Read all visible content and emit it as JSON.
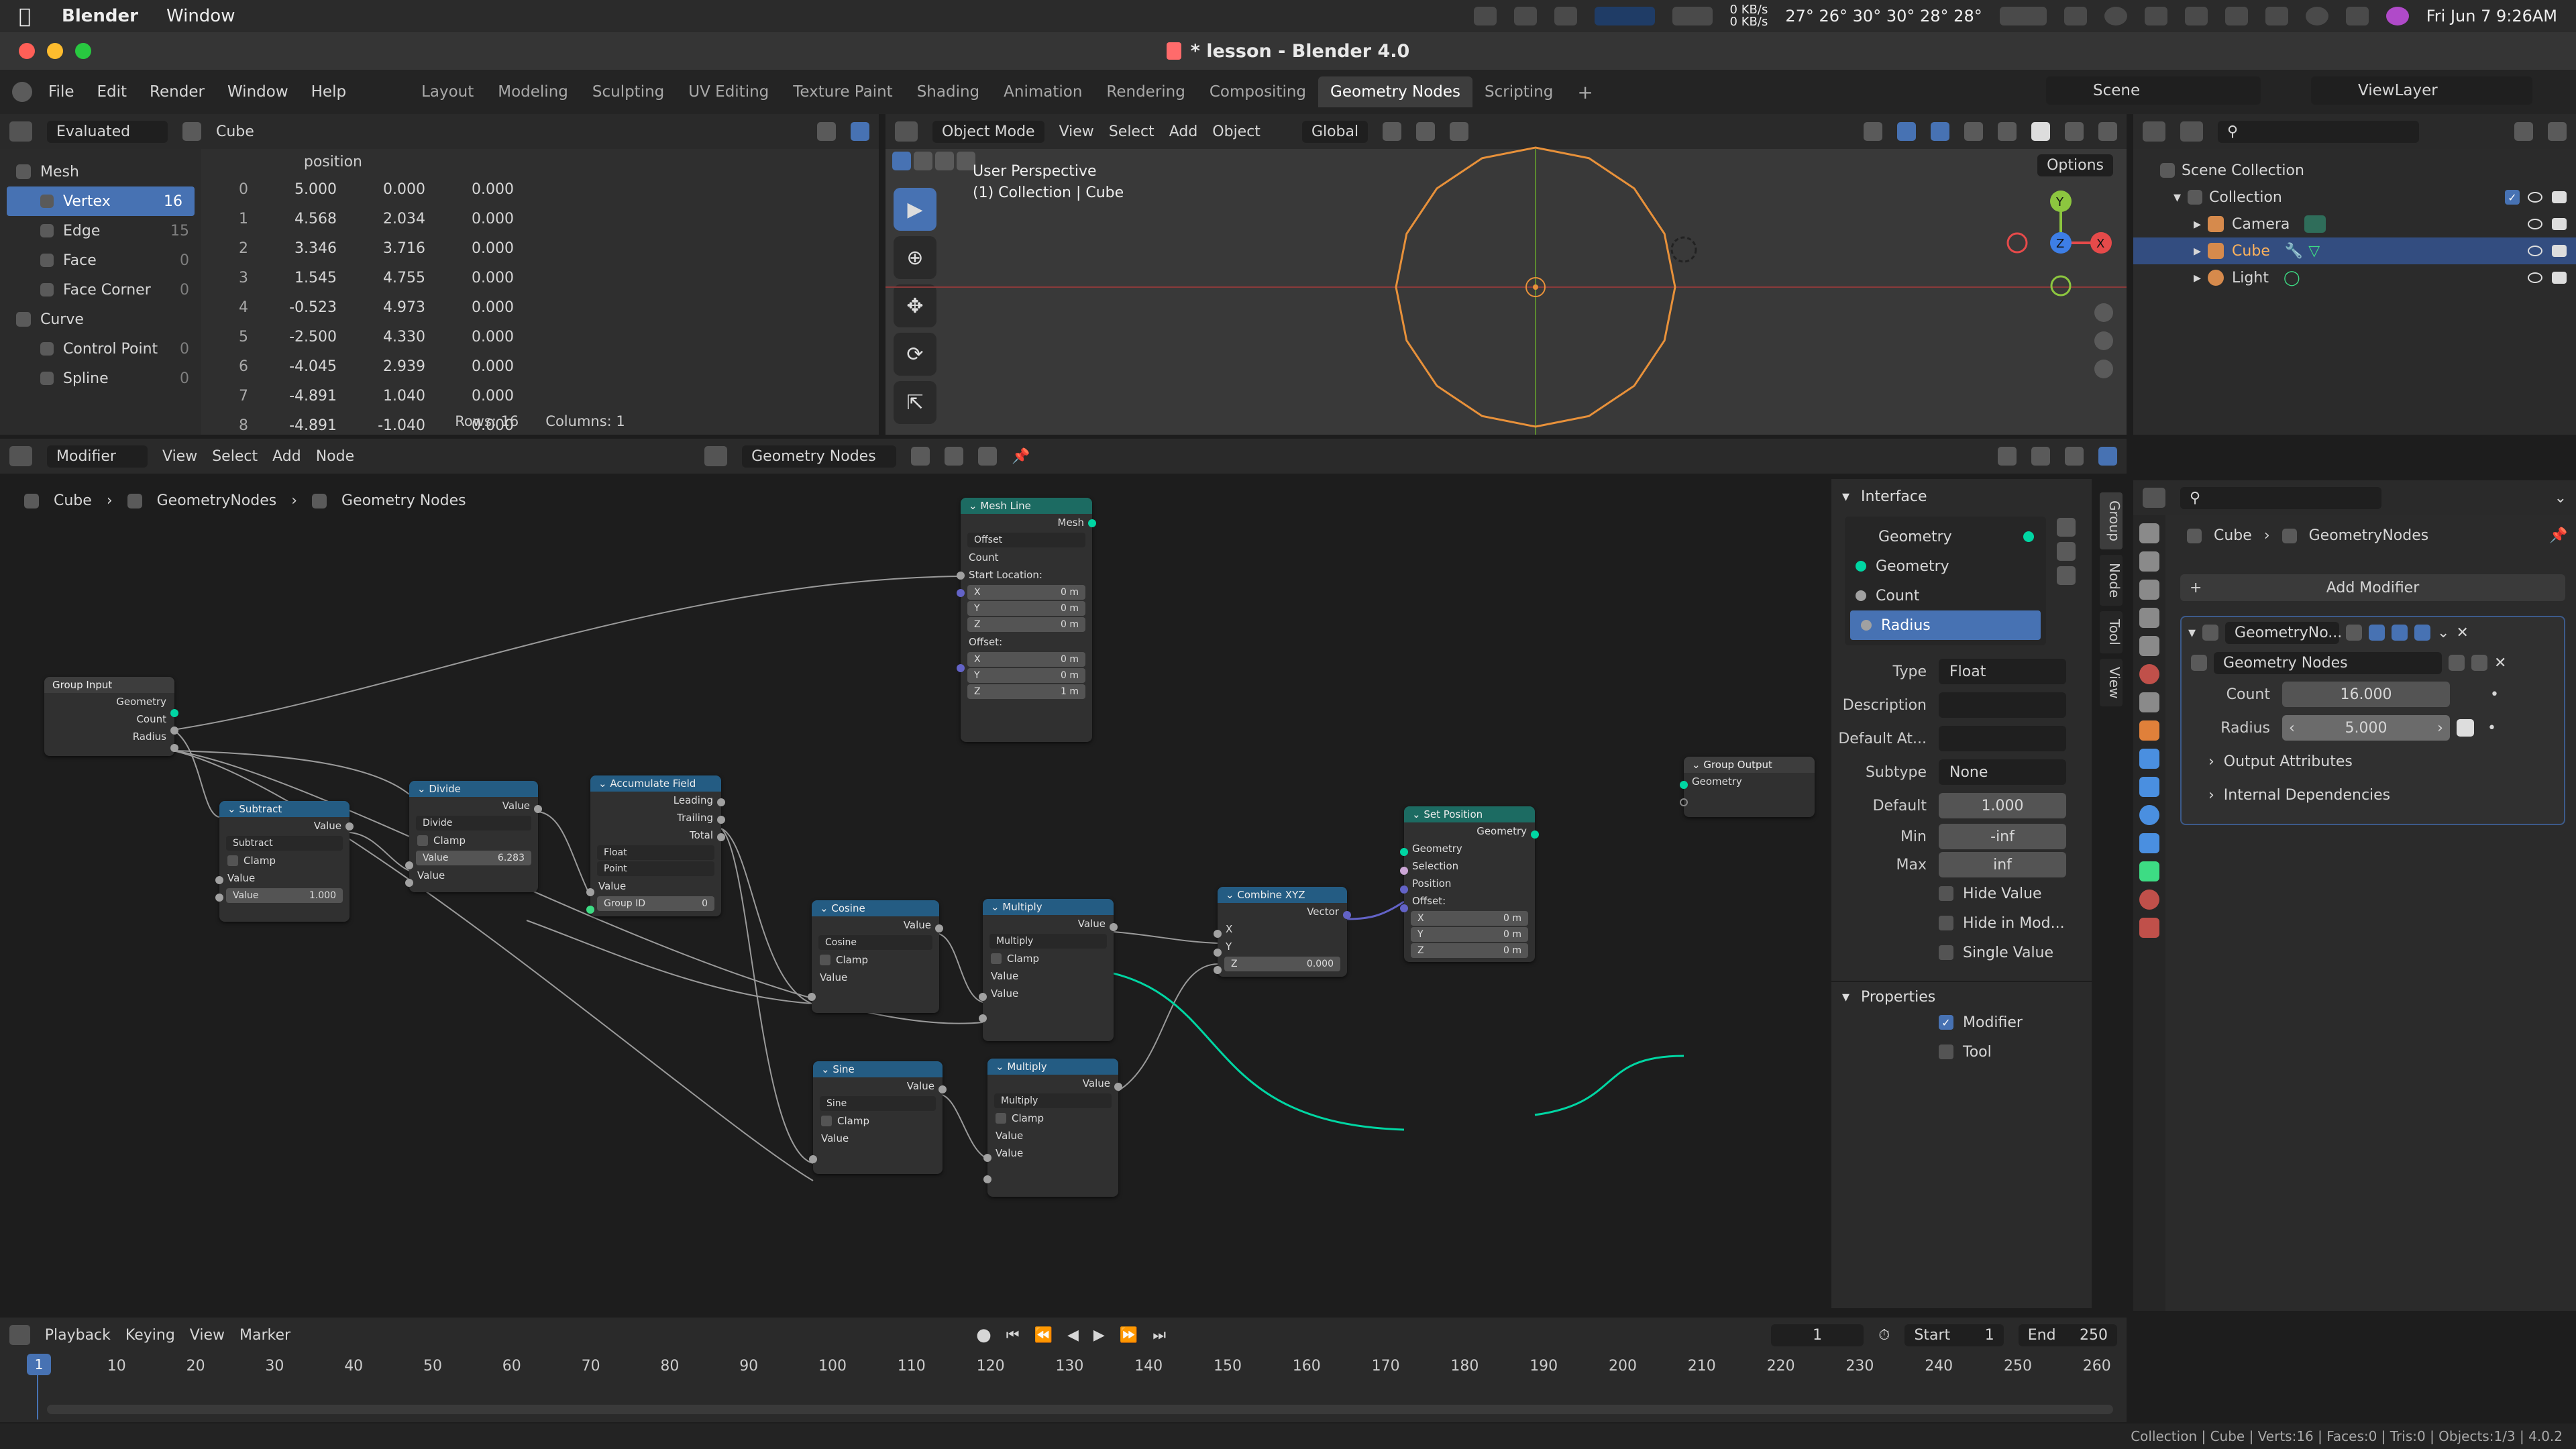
{
  "menubar": {
    "app": "Blender",
    "menu": "Window",
    "net_up": "0 KB/s",
    "net_down": "0 KB/s",
    "temps": "27° 26° 30° 30° 28° 28°",
    "datetime": "Fri Jun 7  9:26AM"
  },
  "window": {
    "title": "* lesson - Blender 4.0"
  },
  "topbar": {
    "menus": [
      "File",
      "Edit",
      "Render",
      "Window",
      "Help"
    ],
    "workspaces": [
      "Layout",
      "Modeling",
      "Sculpting",
      "UV Editing",
      "Texture Paint",
      "Shading",
      "Animation",
      "Rendering",
      "Compositing",
      "Geometry Nodes",
      "Scripting"
    ],
    "active_workspace": "Geometry Nodes",
    "scene": "Scene",
    "view_layer": "ViewLayer"
  },
  "spreadsheet": {
    "mode": "Evaluated",
    "object": "Cube",
    "column_header": "position",
    "domains": [
      {
        "group": "Mesh"
      },
      {
        "label": "Vertex",
        "count": "16",
        "selected": true
      },
      {
        "label": "Edge",
        "count": "15"
      },
      {
        "label": "Face",
        "count": "0"
      },
      {
        "label": "Face Corner",
        "count": "0"
      },
      {
        "group": "Curve"
      },
      {
        "label": "Control Point",
        "count": "0"
      },
      {
        "label": "Spline",
        "count": "0"
      }
    ],
    "rows": [
      [
        "0",
        "5.000",
        "0.000",
        "0.000"
      ],
      [
        "1",
        "4.568",
        "2.034",
        "0.000"
      ],
      [
        "2",
        "3.346",
        "3.716",
        "0.000"
      ],
      [
        "3",
        "1.545",
        "4.755",
        "0.000"
      ],
      [
        "4",
        "-0.523",
        "4.973",
        "0.000"
      ],
      [
        "5",
        "-2.500",
        "4.330",
        "0.000"
      ],
      [
        "6",
        "-4.045",
        "2.939",
        "0.000"
      ],
      [
        "7",
        "-4.891",
        "1.040",
        "0.000"
      ],
      [
        "8",
        "-4.891",
        "-1.040",
        "0.000"
      ]
    ],
    "rows_label": "Rows: 16",
    "cols_label": "Columns: 1"
  },
  "viewport": {
    "mode": "Object Mode",
    "menus": [
      "View",
      "Select",
      "Add",
      "Object"
    ],
    "orientation": "Global",
    "options": "Options",
    "info_line1": "User Perspective",
    "info_line2": "(1) Collection | Cube"
  },
  "node_editor": {
    "header_mode": "Modifier",
    "menus": [
      "View",
      "Select",
      "Add",
      "Node"
    ],
    "tree_name": "Geometry Nodes",
    "breadcrumb": [
      "Cube",
      "GeometryNodes",
      "Geometry Nodes"
    ],
    "nodes": {
      "group_input": {
        "title": "Group Input",
        "out": [
          "Geometry",
          "Count",
          "Radius"
        ]
      },
      "subtract": {
        "title": "Subtract",
        "out": "Value",
        "op": "Subtract",
        "clamp": "Clamp",
        "in": "Value",
        "val_label": "Value",
        "val": "1.000"
      },
      "divide": {
        "title": "Divide",
        "out": "Value",
        "op": "Divide",
        "clamp": "Clamp",
        "val_label": "Value",
        "val": "6.283",
        "in": "Value"
      },
      "accumulate": {
        "title": "Accumulate Field",
        "outs": [
          "Leading",
          "Trailing",
          "Total"
        ],
        "type": "Float",
        "domain": "Point",
        "in": "Value",
        "gid": "Group ID",
        "gid_val": "0"
      },
      "mesh_line": {
        "title": "Mesh Line",
        "out": "Mesh",
        "mode": "Offset",
        "count": "Count",
        "start": "Start Location:",
        "sx": "0 m",
        "sy": "0 m",
        "sz": "0 m",
        "offset": "Offset:",
        "ox": "0 m",
        "oy": "0 m",
        "oz": "1 m"
      },
      "cosine": {
        "title": "Cosine",
        "out": "Value",
        "op": "Cosine",
        "clamp": "Clamp",
        "in": "Value"
      },
      "sine": {
        "title": "Sine",
        "out": "Value",
        "op": "Sine",
        "clamp": "Clamp",
        "in": "Value"
      },
      "multiply1": {
        "title": "Multiply",
        "out": "Value",
        "op": "Multiply",
        "clamp": "Clamp",
        "in1": "Value",
        "in2": "Value"
      },
      "multiply2": {
        "title": "Multiply",
        "out": "Value",
        "op": "Multiply",
        "clamp": "Clamp",
        "in1": "Value",
        "in2": "Value"
      },
      "combine": {
        "title": "Combine XYZ",
        "out": "Vector",
        "x": "X",
        "y": "Y",
        "z": "Z",
        "zval": "0.000"
      },
      "set_position": {
        "title": "Set Position",
        "out": "Geometry",
        "ins": [
          "Geometry",
          "Selection",
          "Position",
          "Offset:"
        ],
        "ox": "0 m",
        "oy": "0 m",
        "oz": "0 m"
      },
      "group_output": {
        "title": "Group Output",
        "in": "Geometry"
      }
    }
  },
  "interface_panel": {
    "title": "Interface",
    "items": [
      {
        "label": "Geometry",
        "kind": "output",
        "color": "#00d6a3"
      },
      {
        "label": "Geometry",
        "kind": "input",
        "color": "#00d6a3"
      },
      {
        "label": "Count",
        "kind": "input",
        "color": "#a1a1a1"
      },
      {
        "label": "Radius",
        "kind": "input",
        "color": "#a1a1a1",
        "selected": true
      }
    ],
    "type_label": "Type",
    "type_val": "Float",
    "desc_label": "Description",
    "default_attr_label": "Default At...",
    "subtype_label": "Subtype",
    "subtype_val": "None",
    "default_label": "Default",
    "default_val": "1.000",
    "min_label": "Min",
    "min_val": "-inf",
    "max_label": "Max",
    "max_val": "inf",
    "hide_value": "Hide Value",
    "hide_in_mod": "Hide in Mod...",
    "single_value": "Single Value",
    "properties_title": "Properties",
    "modifier_cb": "Modifier",
    "tool_cb": "Tool",
    "tabs": [
      "Group",
      "Node",
      "Tool",
      "View"
    ]
  },
  "outliner": {
    "root": "Scene Collection",
    "collection": "Collection",
    "items": [
      "Camera",
      "Cube",
      "Light"
    ],
    "selected": "Cube"
  },
  "properties": {
    "breadcrumb": [
      "Cube",
      "GeometryNodes"
    ],
    "add_modifier": "Add Modifier",
    "modifier_name": "GeometryNo...",
    "node_group": "Geometry Nodes",
    "count_label": "Count",
    "count_val": "16.000",
    "radius_label": "Radius",
    "radius_val": "5.000",
    "output_attrs": "Output Attributes",
    "internal_deps": "Internal Dependencies"
  },
  "timeline": {
    "menus": [
      "Playback",
      "Keying",
      "View",
      "Marker"
    ],
    "current_frame": "1",
    "start_label": "Start",
    "start_val": "1",
    "end_label": "End",
    "end_val": "250",
    "ticks": [
      "1",
      "10",
      "20",
      "30",
      "40",
      "50",
      "60",
      "70",
      "80",
      "90",
      "100",
      "110",
      "120",
      "130",
      "140",
      "150",
      "160",
      "170",
      "180",
      "190",
      "200",
      "210",
      "220",
      "230",
      "240",
      "250",
      "260"
    ]
  },
  "statusbar": {
    "text": "Collection | Cube | Verts:16 | Faces:0 | Tris:0 | Objects:1/3 | 4.0.2"
  },
  "colors": {
    "accent": "#4772b3",
    "geometry_socket": "#00d6a3",
    "geo_header": "#1c6b62",
    "conv_header": "#245c83",
    "circle": "#e8913a"
  }
}
